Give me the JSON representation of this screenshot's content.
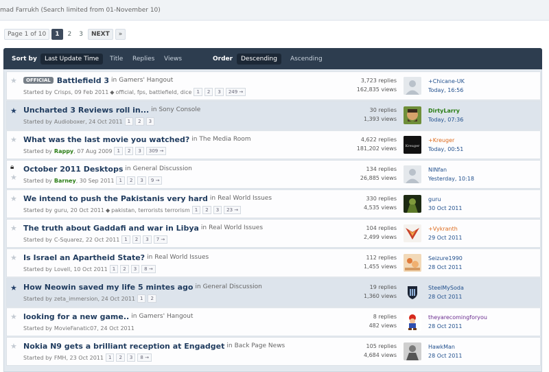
{
  "search_note": "mad Farrukh (Search limited from 01-November 10)",
  "pagination": {
    "page_of": "Page 1 of 10",
    "pages": [
      "1",
      "2",
      "3"
    ],
    "next": "NEXT",
    "last": "»"
  },
  "sortbar": {
    "sort_by": "Sort by",
    "sort_options": [
      "Last Update Time",
      "Title",
      "Replies",
      "Views"
    ],
    "order": "Order",
    "order_options": [
      "Descending",
      "Ascending"
    ]
  },
  "topics": [
    {
      "badge": "OFFICIAL",
      "title": "Battlefield 3",
      "in": "in",
      "forum": "Gamers' Hangout",
      "started_prefix": "Started by",
      "author": "Crisps",
      "date": ", 09 Feb 2011",
      "tags": "official, fps, battlefield, dice",
      "pages": [
        "1",
        "2",
        "3"
      ],
      "last_page": "249 →",
      "replies": "3,723 replies",
      "views": "162,835 views",
      "last_poster": "+Chicane-UK",
      "last_time": "Today, 16:56"
    },
    {
      "title": "Uncharted 3 Reviews roll in...",
      "in": "in",
      "forum": "Sony Console",
      "started_prefix": "Started by",
      "author": "Audioboxer",
      "date": ", 24 Oct 2011",
      "pages": [
        "1",
        "2",
        "3"
      ],
      "replies": "30 replies",
      "views": "1,393 views",
      "last_poster": "DirtyLarry",
      "last_time": "Today, 07:36"
    },
    {
      "title": "What was the last movie you watched?",
      "in": "in",
      "forum": "The Media Room",
      "started_prefix": "Started by",
      "author": "Rappy",
      "date": ", 07 Aug 2009",
      "pages": [
        "1",
        "2",
        "3"
      ],
      "last_page": "309 →",
      "replies": "4,622 replies",
      "views": "181,202 views",
      "last_poster": "+Kreuger",
      "last_time": "Today, 00:51",
      "avatar_text": "Kreuger"
    },
    {
      "title": "October 2011 Desktops",
      "in": "in",
      "forum": "General Discussion",
      "started_prefix": "Started by",
      "author": "Barney",
      "date": ", 30 Sep 2011",
      "pages": [
        "1",
        "2",
        "3"
      ],
      "last_page": "9 →",
      "replies": "134 replies",
      "views": "26,885 views",
      "last_poster": "NINfan",
      "last_time": "Yesterday, 10:18"
    },
    {
      "title": "We intend to push the Pakistanis very hard",
      "in": "in",
      "forum": "Real World Issues",
      "started_prefix": "Started by",
      "author": "guru",
      "date": ", 20 Oct 2011",
      "tags": "pakistan, terrorists terrorism",
      "pages": [
        "1",
        "2",
        "3"
      ],
      "last_page": "23 →",
      "replies": "330 replies",
      "views": "4,535 views",
      "last_poster": "guru",
      "last_time": "30 Oct 2011"
    },
    {
      "title": "The truth about Gaddafi and war in Libya",
      "in": "in",
      "forum": "Real World Issues",
      "started_prefix": "Started by",
      "author": "C-Squarez",
      "date": ", 22 Oct 2011",
      "pages": [
        "1",
        "2",
        "3"
      ],
      "last_page": "7 →",
      "replies": "104 replies",
      "views": "2,499 views",
      "last_poster": "+Vykranth",
      "last_time": "29 Oct 2011"
    },
    {
      "title": "Is Israel an Apartheid State?",
      "in": "in",
      "forum": "Real World Issues",
      "started_prefix": "Started by",
      "author": "Lovell",
      "date": ", 10 Oct 2011",
      "pages": [
        "1",
        "2",
        "3"
      ],
      "last_page": "8 →",
      "replies": "112 replies",
      "views": "1,455 views",
      "last_poster": "Seizure1990",
      "last_time": "28 Oct 2011"
    },
    {
      "title": "How Neowin saved my life 5 mintes ago",
      "in": "in",
      "forum": "General Discussion",
      "started_prefix": "Started by",
      "author": "zeta_immersion",
      "date": ", 24 Oct 2011",
      "pages": [
        "1",
        "2"
      ],
      "replies": "19 replies",
      "views": "1,360 views",
      "last_poster": "SteelMySoda",
      "last_time": "28 Oct 2011"
    },
    {
      "title": "looking for a new game..",
      "in": "in",
      "forum": "Gamers' Hangout",
      "started_prefix": "Started by",
      "author": "MovieFanatic07",
      "date": ", 24 Oct 2011",
      "replies": "8 replies",
      "views": "482 views",
      "last_poster": "theyarecomingforyou",
      "last_time": "28 Oct 2011"
    },
    {
      "title": "Nokia N9 gets a brilliant reception at Engadget",
      "in": "in",
      "forum": "Back Page News",
      "started_prefix": "Started by",
      "author": "FMH",
      "date": ", 23 Oct 2011",
      "pages": [
        "1",
        "2",
        "3"
      ],
      "last_page": "8 →",
      "replies": "105 replies",
      "views": "4,684 views",
      "last_poster": "HawkMan",
      "last_time": "28 Oct 2011"
    }
  ],
  "colors": {
    "sortbar_bg": "#2d3d4f",
    "title_link": "#1f3b5e",
    "starred_row_bg": "#dde4ec",
    "green_user": "#2a7d14",
    "orange_user": "#dd6a1c",
    "blue_user": "#1f4e8c",
    "purple_user": "#6a2d8f"
  },
  "icons": {
    "star_empty": "star-outline-icon",
    "star_filled": "star-filled-icon",
    "lock": "lock-icon",
    "tag": "tag-icon"
  }
}
